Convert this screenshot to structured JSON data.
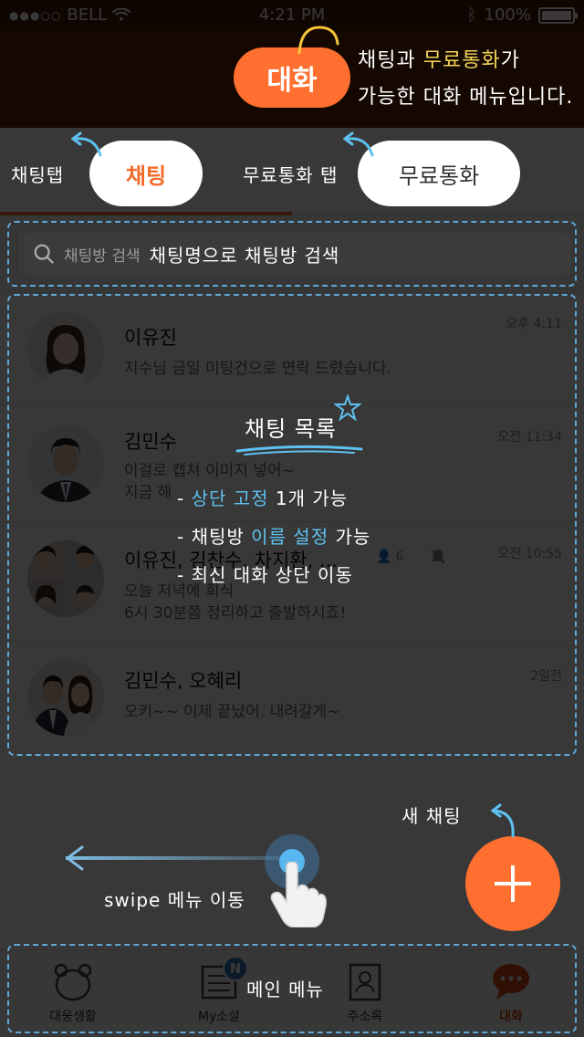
{
  "status_bar": {
    "carrier": "BELL",
    "time": "4:21 PM",
    "battery": "100%"
  },
  "header": {
    "title": "대화"
  },
  "tabs": {
    "chat_label": "채팅",
    "call_label": "무료통화"
  },
  "search": {
    "placeholder": "채팅방 검색"
  },
  "chats": [
    {
      "name": "이유진",
      "message": "지수님 금일 미팅건으로 연락 드렸습니다.",
      "time": "오후 4:11"
    },
    {
      "name": "김민수",
      "message_line1": "이걸로 캡쳐 이미지 넣어~",
      "message_line2": "지금 해",
      "time": "오전 11:34"
    },
    {
      "name": "이유진, 김찬수, 차지환, ...",
      "members": "6",
      "message_line1": "오늘 저녁에 회식",
      "message_line2": "6시 30분쯤 정리하고 출발하시죠!",
      "time": "오전 10:55"
    },
    {
      "name": "김민수, 오혜리",
      "message": "오키~~ 이제 끝났어. 내려갈게~",
      "time": "2일전"
    }
  ],
  "bottom_nav": [
    {
      "label": "대웅생활",
      "icon": "bear-icon"
    },
    {
      "label": "My소셜",
      "icon": "list-icon",
      "badge": "N"
    },
    {
      "label": "주소록",
      "icon": "contact-book-icon"
    },
    {
      "label": "대화",
      "icon": "chat-bubble-icon",
      "active": true
    }
  ],
  "guide": {
    "title_note_line1_a": "채팅과 ",
    "title_note_line1_b": "무료통화",
    "title_note_line1_c": "가",
    "title_note_line2": "가능한 대화 메뉴입니다.",
    "chat_tab_note": "채팅탭",
    "call_tab_note": "무료통화 탭",
    "search_note": "채팅명으로 채팅방 검색",
    "list_title": "채팅 목록",
    "list_item1_a": "- ",
    "list_item1_b": "상단 고정",
    "list_item1_c": " 1개 가능",
    "list_item2_a": "- 채팅방 ",
    "list_item2_b": "이름 설정",
    "list_item2_c": " 가능",
    "list_item3": "- 최신 대화 상단 이동",
    "new_chat_note": "새 채팅",
    "swipe_note": "swipe 메뉴 이동",
    "main_menu_note": "메인 메뉴"
  },
  "colors": {
    "accent": "#ff6f2f",
    "header_bg": "#5b2508",
    "highlight_yellow": "#f5d55a",
    "highlight_blue": "#5fc1f0",
    "dash_blue": "#5fa9d8"
  }
}
